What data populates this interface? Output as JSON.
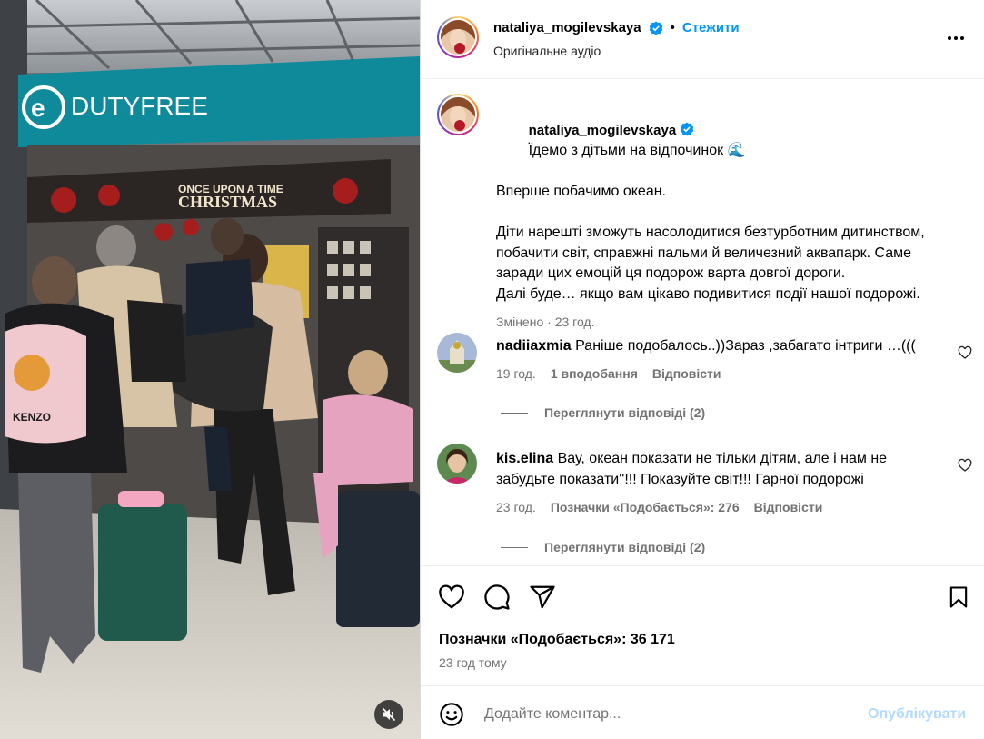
{
  "post": {
    "author": {
      "username": "nataliya_mogilevskaya",
      "verified": true,
      "follow_label": "Стежити",
      "audio_label": "Оригінальне аудіо",
      "avatar_icon": "avatar-photo-icon"
    },
    "media": {
      "store_sign": "DUTYFREE",
      "christmas_banner_line1": "ONCE UPON A TIME",
      "christmas_banner_line2": "CHRISTMAS",
      "backpack_brand": "KENZO",
      "mute_icon": "speaker-muted-icon"
    },
    "caption": {
      "username": "nataliya_mogilevskaya",
      "text_line1": "Їдемо з дітьми на відпочинок 🌊",
      "text_rest": "Вперше побачимо океан.\n\nДіти нарешті зможуть насолодитися безтурботним дитинством, побачити світ, справжні пальми й величезний аквапарк. Саме заради цих емоцій ця подорож варта довгої дороги.\nДалі буде… якщо вам цікаво подивитися події нашої подорожі.",
      "edited": "Змінено",
      "time": "23 год."
    },
    "comments": [
      {
        "username": "nadiiaxmia",
        "text": "Раніше подобалось..))Зараз ,забагато інтриги …(((",
        "time": "19 год.",
        "likes_label": "1 вподобання",
        "reply_label": "Відповісти",
        "view_replies": "Переглянути відповіді (2)"
      },
      {
        "username": "kis.elina",
        "text": "Вау, океан показати не тільки дітям, але і нам не забудьте показати''!!! Показуйте світ!!! Гарної подорожі",
        "time": "23 год.",
        "likes_label": "Позначки «Подобається»: 276",
        "reply_label": "Відповісти",
        "view_replies": "Переглянути відповіді (2)"
      }
    ],
    "actions": {
      "like_icon": "heart-icon",
      "comment_icon": "comment-icon",
      "share_icon": "send-icon",
      "save_icon": "bookmark-icon"
    },
    "likes_text": "Позначки «Подобається»: 36 171",
    "posted_time": "23 год тому",
    "add_comment": {
      "emoji_icon": "emoji-icon",
      "placeholder": "Додайте коментар...",
      "publish_label": "Опублікувати"
    },
    "colors": {
      "link_blue": "#0095f6",
      "publish_disabled": "#b3dbff",
      "muted_text": "#737373"
    }
  }
}
